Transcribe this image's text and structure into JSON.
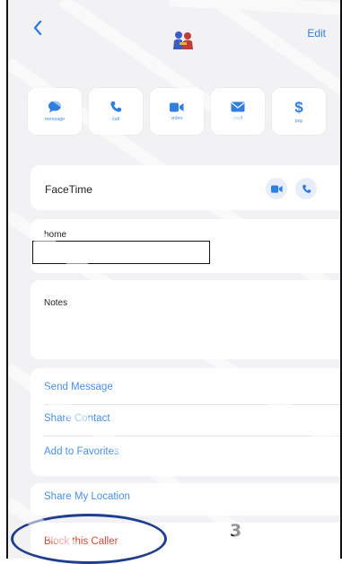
{
  "header": {
    "back_icon": "chevron-left-icon",
    "avatar_icon": "people-icon",
    "edit_label": "Edit"
  },
  "actions": [
    {
      "icon": "message-icon",
      "label": "message"
    },
    {
      "icon": "phone-icon",
      "label": "call"
    },
    {
      "icon": "video-icon",
      "label": "video"
    },
    {
      "icon": "mail-icon",
      "label": "mail"
    },
    {
      "icon": "dollar-icon",
      "label": "pay"
    }
  ],
  "facetime": {
    "label": "FaceTime",
    "video_icon": "video-icon",
    "call_icon": "phone-icon"
  },
  "home": {
    "label": "home",
    "value": ""
  },
  "notes": {
    "label": "Notes"
  },
  "links": {
    "send_message": "Send Message",
    "share_contact": "Share Contact",
    "add_favorites": "Add to Favorites",
    "share_location": "Share My Location",
    "block_caller": "Block this Caller"
  },
  "annotation": {
    "step_number": "3"
  },
  "colors": {
    "accent": "#4a8fe0",
    "danger": "#e0453a",
    "annotation": "#1f3f8e"
  }
}
